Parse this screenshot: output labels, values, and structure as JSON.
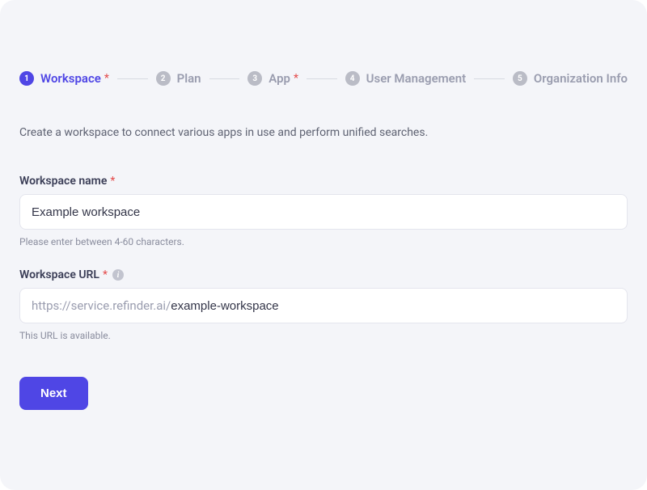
{
  "stepper": {
    "steps": [
      {
        "num": "1",
        "label": "Workspace",
        "required": true,
        "active": true
      },
      {
        "num": "2",
        "label": "Plan",
        "required": false,
        "active": false
      },
      {
        "num": "3",
        "label": "App",
        "required": true,
        "active": false
      },
      {
        "num": "4",
        "label": "User Management",
        "required": false,
        "active": false
      },
      {
        "num": "5",
        "label": "Organization Info",
        "required": false,
        "active": false
      }
    ]
  },
  "description": "Create a workspace to connect various apps in use and perform unified searches.",
  "fields": {
    "workspace_name": {
      "label": "Workspace name",
      "value": "Example workspace",
      "hint": "Please enter between 4-60 characters."
    },
    "workspace_url": {
      "label": "Workspace URL",
      "prefix": "https://service.refinder.ai/",
      "value": "example-workspace",
      "hint": "This URL is available."
    }
  },
  "buttons": {
    "next": "Next"
  },
  "asterisk": "*",
  "info_glyph": "i"
}
